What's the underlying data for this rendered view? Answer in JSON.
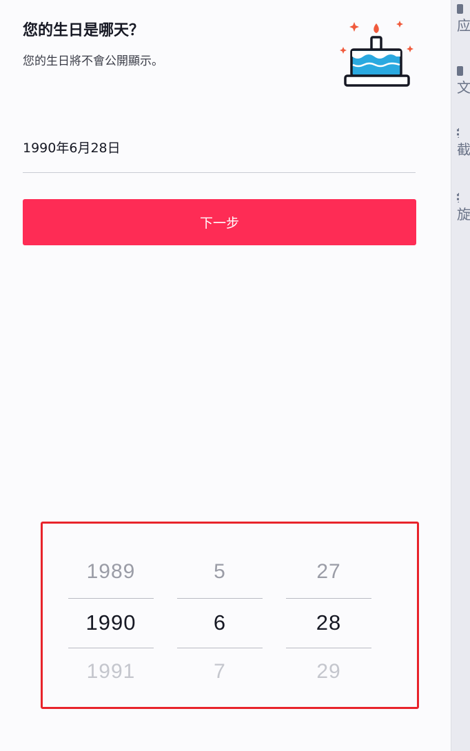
{
  "header": {
    "title": "您的生日是哪天？",
    "subtitle": "您的生日將不會公開顯示。"
  },
  "birthday_field": {
    "value": "1990年6月28日"
  },
  "next_button": {
    "label": "下一步"
  },
  "date_picker": {
    "year": {
      "prev": "1989",
      "selected": "1990",
      "next": "1991"
    },
    "month": {
      "prev": "5",
      "selected": "6",
      "next": "7"
    },
    "day": {
      "prev": "27",
      "selected": "28",
      "next": "29"
    }
  },
  "side_panel": {
    "labels": [
      "应",
      "文",
      "截",
      "旋"
    ]
  },
  "colors": {
    "accent": "#fe2c55",
    "highlight_frame": "#e8232b",
    "cake_body": "#2aa9e0",
    "candle_flame": "#f05a3c",
    "text_primary": "#161823"
  },
  "icons": [
    "birthday-cake-icon"
  ]
}
